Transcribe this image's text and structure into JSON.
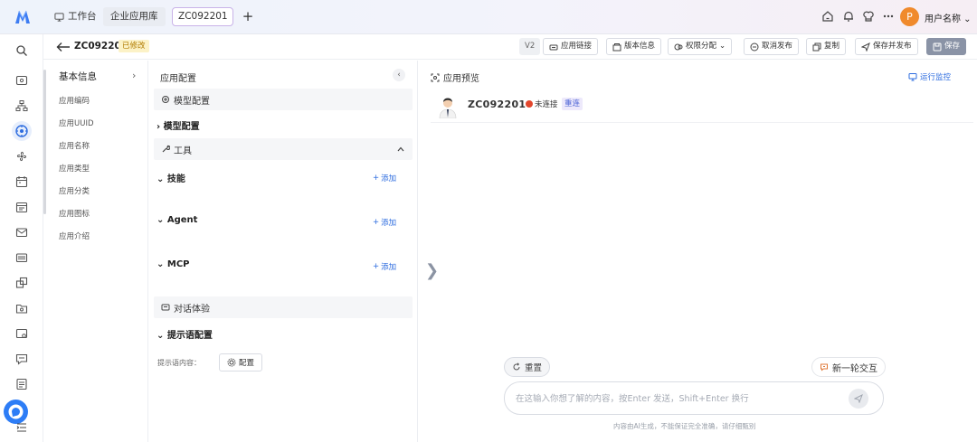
{
  "topbar": {
    "workbench_label": "工作台",
    "app_library_label": "企业应用库",
    "active_tab_label": "ZC092201",
    "add_tab_label": "+",
    "user_initial": "P",
    "user_name": "用户名称"
  },
  "header": {
    "title": "ZC092201",
    "modified_badge": "已修改",
    "version": "V2",
    "buttons": {
      "app_link": "应用链接",
      "version_info": "版本信息",
      "permission": "权限分配",
      "unpublish": "取消发布",
      "copy": "复制",
      "save_publish": "保存并发布",
      "save": "保存"
    }
  },
  "basic_info": {
    "title": "基本信息",
    "fields": [
      "应用编码",
      "应用UUID",
      "应用名称",
      "应用类型",
      "应用分类",
      "应用图标",
      "应用介绍"
    ]
  },
  "config": {
    "title": "应用配置",
    "model_section": "模型配置",
    "model_sub": "模型配置",
    "tools_section": "工具",
    "skills_label": "技能",
    "agent_label": "Agent",
    "mcp_label": "MCP",
    "add_label": "添加",
    "dialog_section": "对话体验",
    "prompt_config": "提示语配置",
    "prompt_content_label": "提示语内容：",
    "configure_button": "配置"
  },
  "preview": {
    "title": "应用预览",
    "monitor_label": "运行监控",
    "agent_name": "ZC092201",
    "status_text": "未连接",
    "reconnect_label": "重连",
    "reset_label": "重置",
    "new_round_label": "新一轮交互",
    "input_placeholder": "在这输入你想了解的内容，按Enter 发送，Shift+Enter 换行",
    "disclaimer": "内容由AI生成，不能保证完全准确，请仔细甄别"
  },
  "colors": {
    "accent": "#2d6cdf",
    "avatar": "#f08a2c",
    "status_error": "#e2462c",
    "save_button": "#8a93a6"
  }
}
